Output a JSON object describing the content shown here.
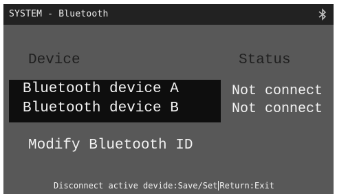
{
  "titlebar": {
    "title": "SYSTEM - Bluetooth",
    "icon": "bluetooth-icon"
  },
  "table": {
    "headers": {
      "device": "Device",
      "status": "Status"
    },
    "rows": [
      {
        "device": "Bluetooth device A",
        "status": "Not connect"
      },
      {
        "device": "Bluetooth device B",
        "status": "Not connect"
      }
    ]
  },
  "menu": {
    "modify_label": "Modify Bluetooth ID"
  },
  "footer": {
    "left": "Disconnect active devide:Save/Set",
    "right": "Return:Exit"
  },
  "colors": {
    "background": "#585858",
    "titlebar": "#222222",
    "selection": "#0e0e0e",
    "text": "#f2f2f2",
    "header_text": "#1f1f1f"
  }
}
